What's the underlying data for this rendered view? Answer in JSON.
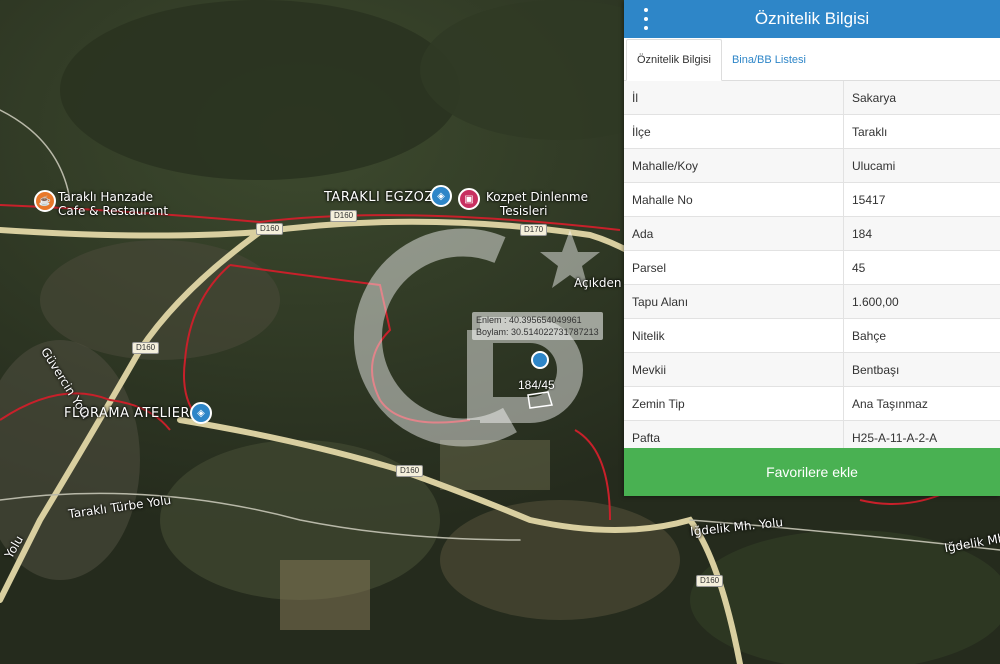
{
  "map": {
    "labels": {
      "hanzade_1": "Taraklı Hanzade",
      "hanzade_2": "Cafe & Restaurant",
      "tarakli_egzoz": "TARAKLI EGZOZ",
      "kozpet_1": "Kozpet Dinlenme",
      "kozpet_2": "Tesisleri",
      "acikden": "Açıkden",
      "guvercin": "Güvercin Yolu",
      "florama": "FLORAMA ATELIER",
      "turbe": "Taraklı Türbe Yolu",
      "igdelik1": "Iğdelik Mh. Yolu",
      "igdelik2": "Iğdelik Mh",
      "yolu_left": "Yolu"
    },
    "road_shields": [
      "D160",
      "D160",
      "D170",
      "D160",
      "D160",
      "D160"
    ],
    "coordinates": {
      "lat": "Enlem : 40.395654049961",
      "lon": "Boylam: 30.514022731787213"
    },
    "parcel_label": "184/45",
    "colors": {
      "road": "#d9cfa0",
      "boundary": "#c8202a",
      "watermark": "#ffffff"
    }
  },
  "panel": {
    "title": "Öznitelik Bilgisi",
    "menu_icon": "vertical-dots-icon",
    "tabs": [
      {
        "label": "Öznitelik Bilgisi",
        "active": true
      },
      {
        "label": "Bina/BB Listesi",
        "active": false
      }
    ],
    "rows": [
      {
        "key": "İl",
        "value": "Sakarya"
      },
      {
        "key": "İlçe",
        "value": "Taraklı"
      },
      {
        "key": "Mahalle/Koy",
        "value": "Ulucami"
      },
      {
        "key": "Mahalle No",
        "value": "15417"
      },
      {
        "key": "Ada",
        "value": "184"
      },
      {
        "key": "Parsel",
        "value": "45"
      },
      {
        "key": "Tapu Alanı",
        "value": "1.600,00"
      },
      {
        "key": "Nitelik",
        "value": "Bahçe"
      },
      {
        "key": "Mevkii",
        "value": "Bentbaşı"
      },
      {
        "key": "Zemin Tip",
        "value": "Ana Taşınmaz"
      },
      {
        "key": "Pafta",
        "value": "H25-A-11-A-2-A"
      }
    ],
    "favorite_button": "Favorilere ekle",
    "colors": {
      "header": "#2e86c8",
      "button": "#49b152"
    }
  }
}
